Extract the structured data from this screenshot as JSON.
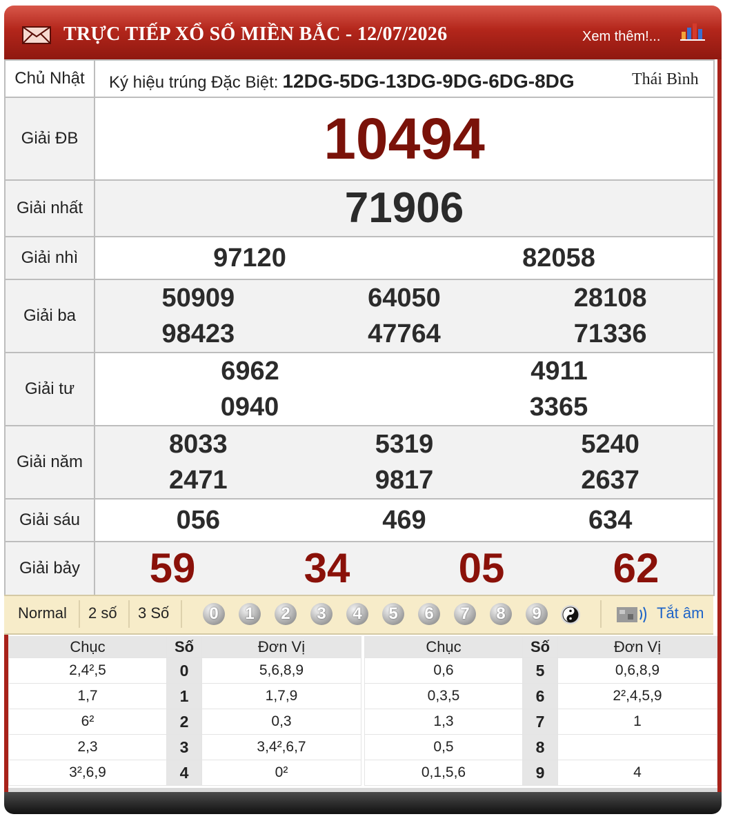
{
  "header": {
    "title": "TRỰC TIẾP XỔ SỐ MIỀN BẮC - 12/07/2026",
    "more_link": "Xem thêm!...",
    "mail_icon": "mail-icon",
    "chart_icon": "bar-chart-icon"
  },
  "info": {
    "day": "Chủ Nhật",
    "symbol_label": "Ký hiệu trúng Đặc Biệt:",
    "symbol_codes": "12DG-5DG-13DG-9DG-6DG-8DG",
    "province": "Thái Bình"
  },
  "prizes": {
    "db": {
      "label": "Giải ĐB",
      "numbers": [
        "10494"
      ]
    },
    "g1": {
      "label": "Giải nhất",
      "numbers": [
        "71906"
      ]
    },
    "g2": {
      "label": "Giải nhì",
      "numbers": [
        "97120",
        "82058"
      ]
    },
    "g3": {
      "label": "Giải ba",
      "numbers": [
        "50909",
        "64050",
        "28108",
        "98423",
        "47764",
        "71336"
      ]
    },
    "g4": {
      "label": "Giải tư",
      "numbers": [
        "6962",
        "4911",
        "0940",
        "3365"
      ]
    },
    "g5": {
      "label": "Giải năm",
      "numbers": [
        "8033",
        "5319",
        "5240",
        "2471",
        "9817",
        "2637"
      ]
    },
    "g6": {
      "label": "Giải sáu",
      "numbers": [
        "056",
        "469",
        "634"
      ]
    },
    "g7": {
      "label": "Giải bảy",
      "numbers": [
        "59",
        "34",
        "05",
        "62"
      ]
    }
  },
  "toolbar": {
    "normal": "Normal",
    "two": "2 số",
    "three": "3 Số",
    "balls": [
      "0",
      "1",
      "2",
      "3",
      "4",
      "5",
      "6",
      "7",
      "8",
      "9"
    ],
    "yinyang_icon": "yin-yang-icon",
    "speaker_icon": "speaker-icon",
    "mute_label": "Tắt âm"
  },
  "loto": {
    "headers": {
      "chuc": "Chục",
      "so": "Số",
      "donvi": "Đơn Vị"
    },
    "left": [
      {
        "chuc": "2,4²,5",
        "so": "0",
        "donvi": "5,6,8,9"
      },
      {
        "chuc": "1,7",
        "so": "1",
        "donvi": "1,7,9"
      },
      {
        "chuc": "6²",
        "so": "2",
        "donvi": "0,3"
      },
      {
        "chuc": "2,3",
        "so": "3",
        "donvi": "3,4²,6,7"
      },
      {
        "chuc": "3²,6,9",
        "so": "4",
        "donvi": "0²"
      }
    ],
    "right": [
      {
        "chuc": "0,6",
        "so": "5",
        "donvi": "0,6,8,9"
      },
      {
        "chuc": "0,3,5",
        "so": "6",
        "donvi": "2²,4,5,9"
      },
      {
        "chuc": "1,3",
        "so": "7",
        "donvi": "1"
      },
      {
        "chuc": "0,5",
        "so": "8",
        "donvi": ""
      },
      {
        "chuc": "0,1,5,6",
        "so": "9",
        "donvi": "4"
      }
    ]
  }
}
